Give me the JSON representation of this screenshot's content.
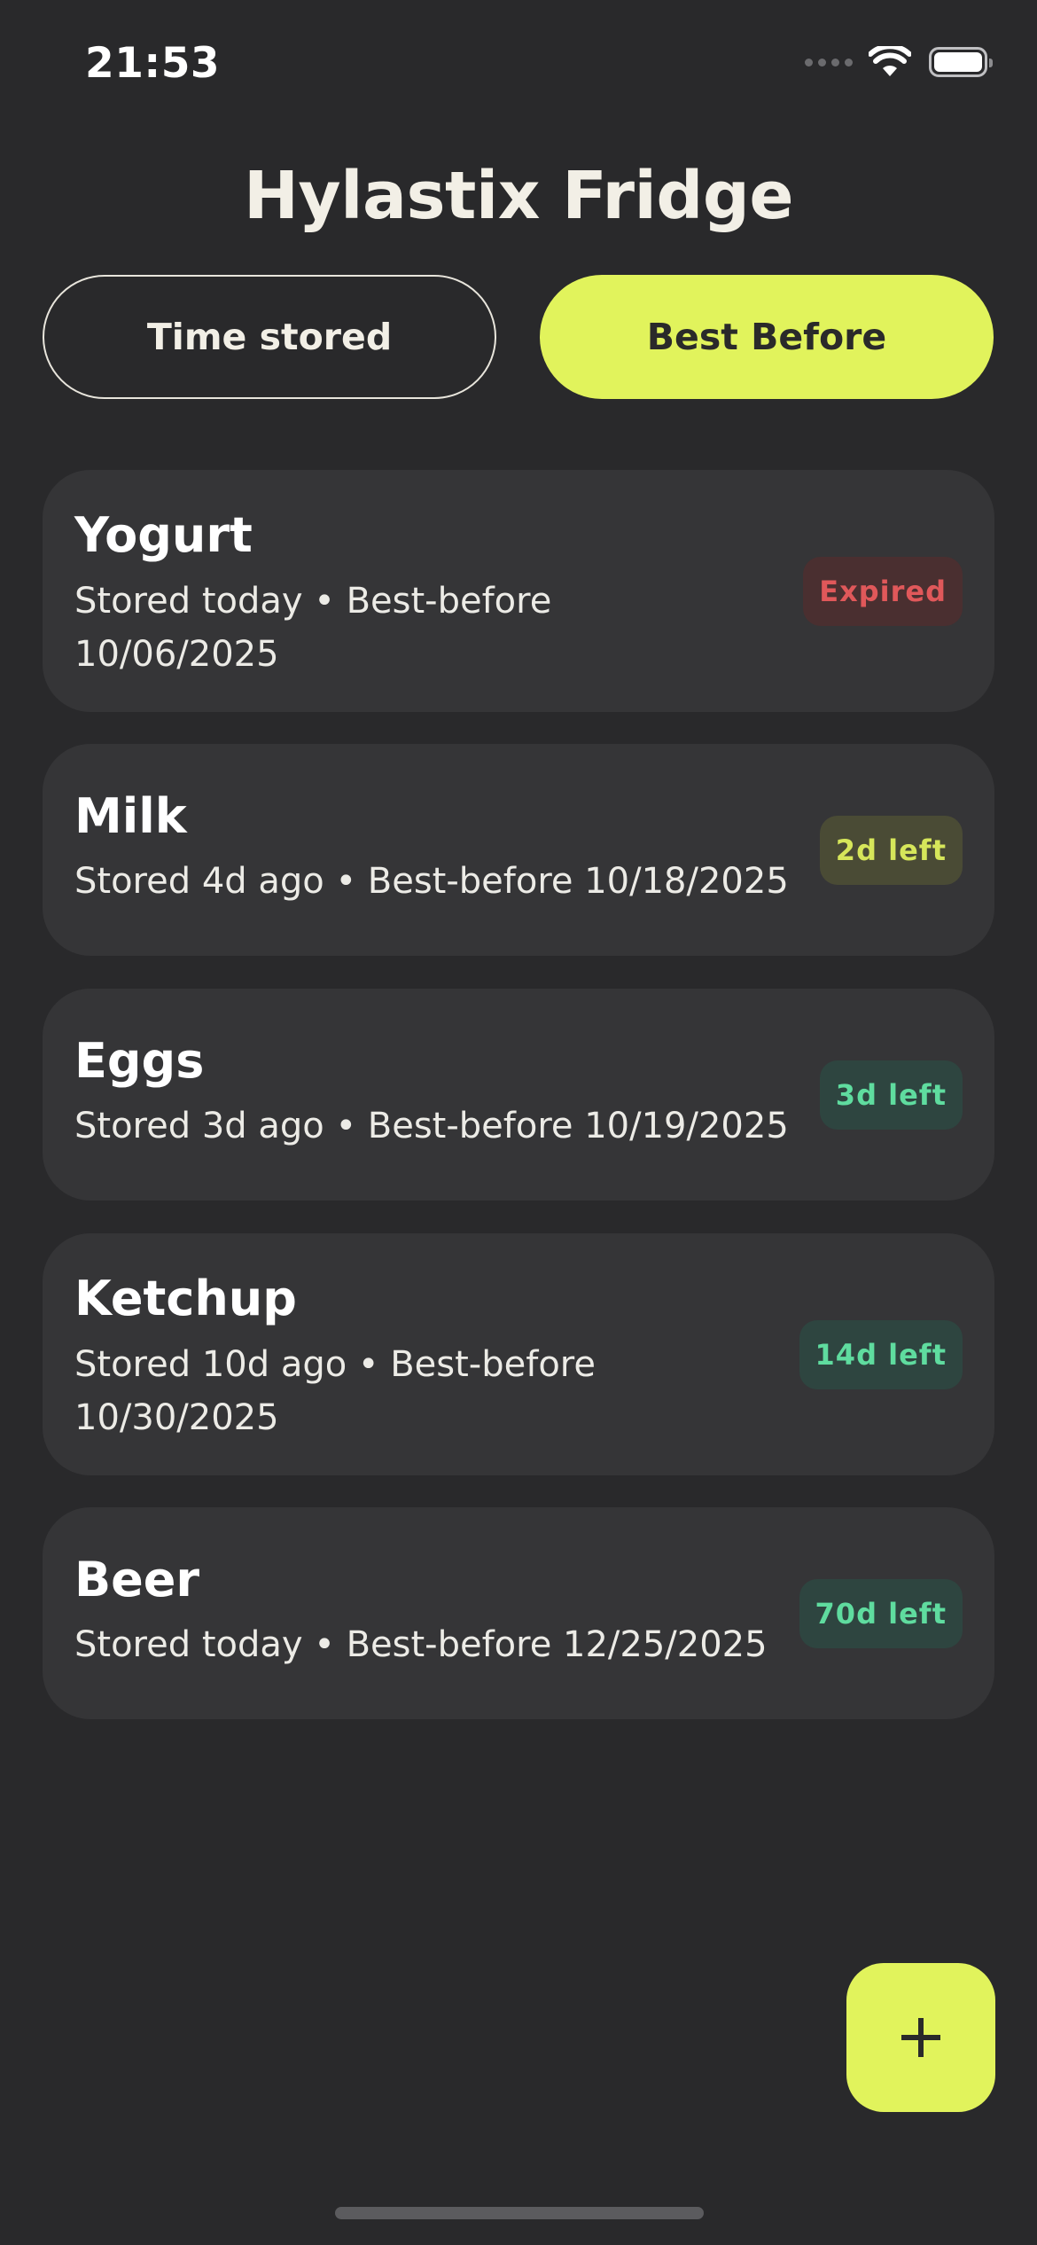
{
  "status_bar": {
    "time": "21:53"
  },
  "app": {
    "title": "Hylastix Fridge"
  },
  "sort": {
    "time_stored_label": "Time stored",
    "best_before_label": "Best Before",
    "active": "Best Before"
  },
  "items": [
    {
      "name": "Yogurt",
      "meta_line1": "Stored today • Best-before",
      "meta_line2": "10/06/2025",
      "badge": "Expired",
      "badge_status": "expired"
    },
    {
      "name": "Milk",
      "meta_line1": "Stored 4d ago • Best-before 10/18/2025",
      "badge": "2d left",
      "badge_status": "soon"
    },
    {
      "name": "Eggs",
      "meta_line1": "Stored 3d ago • Best-before 10/19/2025",
      "badge": "3d left",
      "badge_status": "ok"
    },
    {
      "name": "Ketchup",
      "meta_line1": "Stored 10d ago • Best-before",
      "meta_line2": "10/30/2025",
      "badge": "14d left",
      "badge_status": "ok"
    },
    {
      "name": "Beer",
      "meta_line1": "Stored today • Best-before 12/25/2025",
      "badge": "70d left",
      "badge_status": "ok"
    }
  ],
  "fab": {
    "icon": "plus-icon"
  },
  "colors": {
    "background": "#29292b",
    "card": "#353537",
    "accent": "#e1f35c",
    "expired": "#e0585a",
    "soon": "#d6e65a",
    "ok": "#5fdc9f"
  }
}
